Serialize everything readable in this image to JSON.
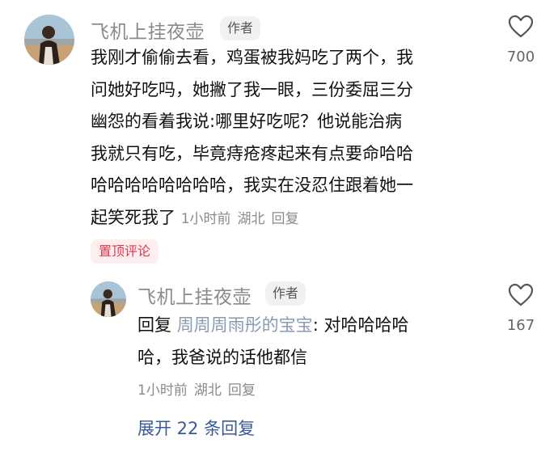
{
  "comment": {
    "author": "飞机上挂夜壶",
    "author_badge": "作者",
    "lines": [
      "我刚才偷偷去看，鸡蛋被我妈吃了两个，我",
      "问她好吃吗，她撇了我一眼，三份委屈三分",
      "幽怨的看着我说:哪里好吃呢？他说能治病",
      "我就只有吃，毕竟痔疮疼起来有点要命哈哈",
      "哈哈哈哈哈哈哈哈，我实在没忍住跟着她一",
      "起笑死我了"
    ],
    "time": "1小时前",
    "location": "湖北",
    "reply_action": "回复",
    "like_count": "700",
    "pinned_label": "置顶评论"
  },
  "reply": {
    "author": "飞机上挂夜壶",
    "author_badge": "作者",
    "prefix": "回复",
    "target": "周周周雨彤的宝宝",
    "line1_rest": ": 对哈哈哈哈",
    "line2": "哈，我爸说的话他都信",
    "time": "1小时前",
    "location": "湖北",
    "reply_action": "回复",
    "like_count": "167"
  },
  "expand_label": "展开 22 条回复",
  "icons": {
    "like": "heart-outline-icon"
  },
  "colors": {
    "author": "#8a8a8a",
    "pinned_text": "#e0354f",
    "pinned_bg": "#fdeef0",
    "link": "#3a5a94",
    "reply_target": "#8a9ab3"
  }
}
